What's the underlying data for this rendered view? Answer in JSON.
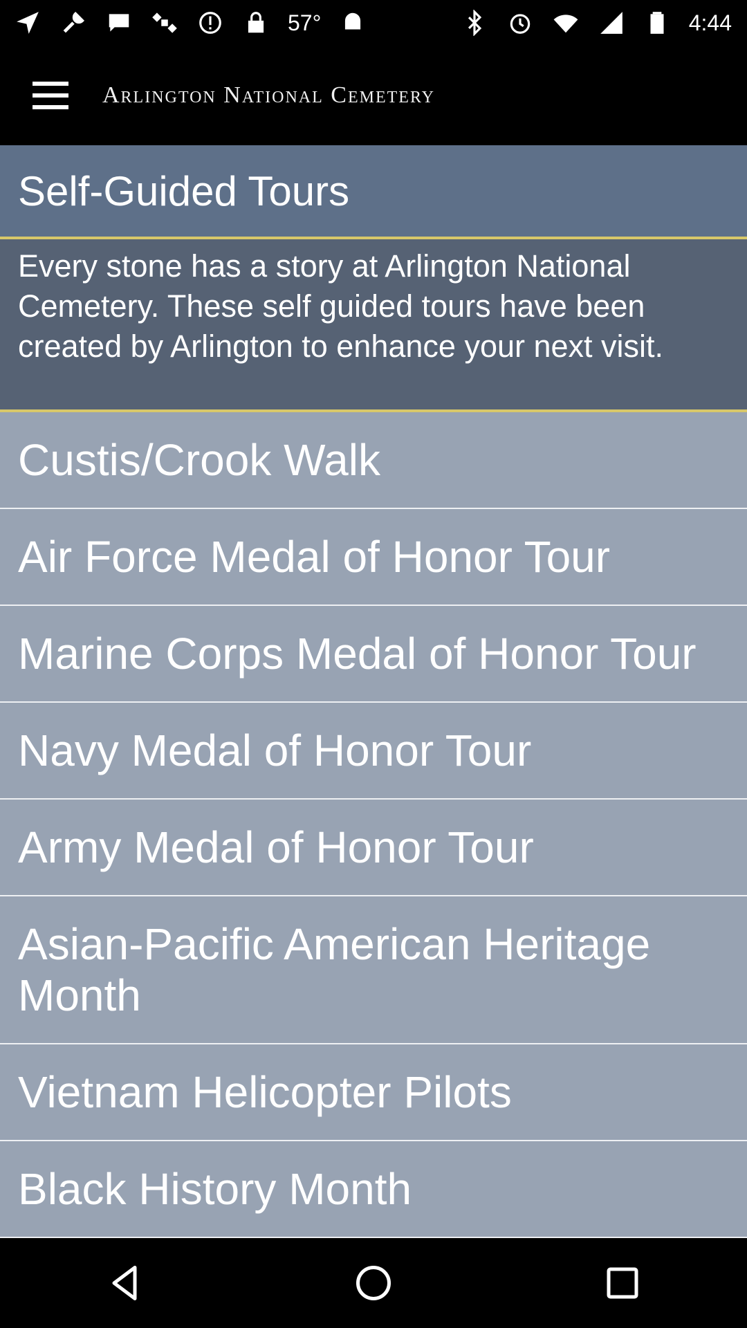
{
  "status_bar": {
    "temperature": "57°",
    "time": "4:44",
    "left_icons": [
      "navigation-icon",
      "wrench-icon",
      "message-icon",
      "satellite-icon",
      "alert-icon",
      "lock-icon",
      "android-icon"
    ],
    "right_icons": [
      "bluetooth-icon",
      "alarm-icon",
      "wifi-icon",
      "signal-icon",
      "battery-icon"
    ]
  },
  "app_bar": {
    "title": "Arlington National Cemetery",
    "menu_icon": "hamburger-menu-icon"
  },
  "section": {
    "title": "Self-Guided Tours",
    "description": "Every stone has a story at Arlington National Cemetery. These self guided tours have been created by Arlington to enhance your next visit."
  },
  "tours": [
    {
      "label": "Custis/Crook Walk"
    },
    {
      "label": "Air Force Medal of Honor Tour"
    },
    {
      "label": "Marine Corps Medal of Honor Tour"
    },
    {
      "label": "Navy Medal of Honor Tour"
    },
    {
      "label": "Army Medal of Honor Tour"
    },
    {
      "label": "Asian-Pacific American Heritage Month"
    },
    {
      "label": "Vietnam Helicopter Pilots"
    },
    {
      "label": "Black History Month"
    }
  ],
  "nav_bar": {
    "buttons": [
      "back-icon",
      "home-icon",
      "recents-icon"
    ]
  },
  "colors": {
    "header_bg": "#5e7089",
    "intro_bg": "#566274",
    "list_bg": "#98a3b3",
    "accent_line": "#d8c86a"
  }
}
